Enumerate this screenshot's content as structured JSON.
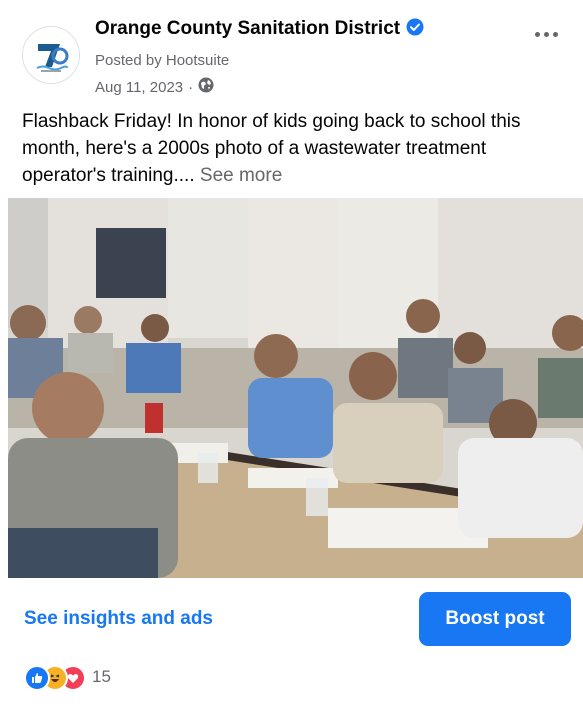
{
  "post": {
    "page_name": "Orange County Sanitation District",
    "posted_by": "Posted by Hootsuite",
    "date": "Aug 11, 2023",
    "separator": "·",
    "caption": "Flashback Friday! In honor of kids going back to school this month, here's a 2000s photo of a wastewater treatment operator's training....",
    "see_more": "See more",
    "icons": {
      "avatar": "ocsd-logo",
      "verified": "verified-badge-icon",
      "privacy": "globe-icon",
      "menu": "more-horizontal-icon"
    }
  },
  "actions": {
    "insights_label": "See insights and ads",
    "boost_label": "Boost post"
  },
  "reactions": {
    "types": [
      "like",
      "haha",
      "love"
    ],
    "count": "15"
  },
  "colors": {
    "accent": "#1877f2",
    "secondary_text": "#65676b",
    "love": "#f33e58",
    "haha": "#f7b125"
  }
}
